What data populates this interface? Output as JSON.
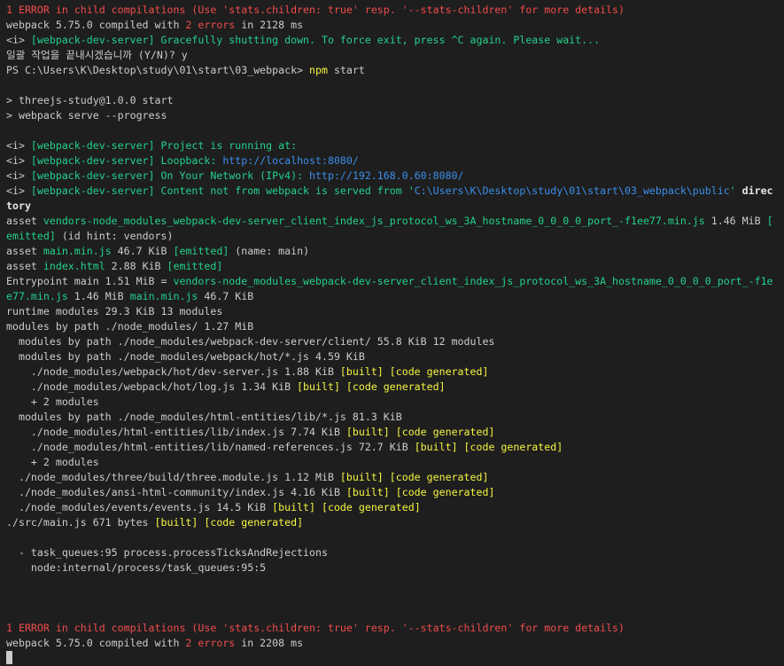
{
  "terminal": {
    "colors": {
      "background": "#1e1e1e",
      "text": "#cccccc",
      "error": "#f14c4c",
      "success": "#23d18b",
      "link": "#3b8eea",
      "highlight": "#f5f543"
    },
    "lines": [
      [
        [
          "1 ERROR in child compilations (Use 'stats.children: true' resp. '--stats-children' for more details)",
          "r"
        ]
      ],
      [
        [
          "webpack 5.75.0 compiled with ",
          ""
        ],
        [
          "2 errors",
          "r"
        ],
        [
          " in 2128 ms",
          ""
        ]
      ],
      [
        [
          "<i> ",
          ""
        ],
        [
          "[webpack-dev-server] Gracefully shutting down. To force exit, press ^C again. Please wait...",
          "g"
        ]
      ],
      [
        [
          "일괄 작업을 끝내시겠습니까 (Y/N)? y",
          ""
        ]
      ],
      [
        [
          "PS C:\\Users\\K\\Desktop\\study\\01\\start\\03_webpack> ",
          ""
        ],
        [
          "npm",
          "y"
        ],
        [
          " start",
          ""
        ]
      ],
      [],
      [
        [
          "> threejs-study@1.0.0 start",
          ""
        ]
      ],
      [
        [
          "> webpack serve --progress",
          ""
        ]
      ],
      [],
      [
        [
          "<i> ",
          ""
        ],
        [
          "[webpack-dev-server] Project is running at:",
          "g"
        ]
      ],
      [
        [
          "<i> ",
          ""
        ],
        [
          "[webpack-dev-server] Loopback: ",
          "g"
        ],
        [
          "http://localhost:8080/",
          "b"
        ]
      ],
      [
        [
          "<i> ",
          ""
        ],
        [
          "[webpack-dev-server] On Your Network (IPv4): ",
          "g"
        ],
        [
          "http://192.168.0.60:8080/",
          "b"
        ]
      ],
      [
        [
          "<i> ",
          ""
        ],
        [
          "[webpack-dev-server] Content not from webpack is served from '",
          "g"
        ],
        [
          "C:\\Users\\K\\Desktop\\study\\01\\start\\03_webpack\\public",
          "b"
        ],
        [
          "'",
          "g"
        ],
        [
          " direc",
          "w"
        ]
      ],
      [
        [
          "tory",
          "w"
        ]
      ],
      [
        [
          "asset ",
          ""
        ],
        [
          "vendors-node_modules_webpack-dev-server_client_index_js_protocol_ws_3A_hostname_0_0_0_0_port_-f1ee77.min.js",
          "g"
        ],
        [
          " 1.46 MiB ",
          ""
        ],
        [
          "[",
          "g"
        ]
      ],
      [
        [
          "emitted]",
          "g"
        ],
        [
          " (id hint: vendors)",
          ""
        ]
      ],
      [
        [
          "asset ",
          ""
        ],
        [
          "main.min.js",
          "g"
        ],
        [
          " 46.7 KiB ",
          ""
        ],
        [
          "[emitted]",
          "g"
        ],
        [
          " (name: main)",
          ""
        ]
      ],
      [
        [
          "asset ",
          ""
        ],
        [
          "index.html",
          "g"
        ],
        [
          " 2.88 KiB ",
          ""
        ],
        [
          "[emitted]",
          "g"
        ]
      ],
      [
        [
          "Entrypoint main 1.51 MiB = ",
          ""
        ],
        [
          "vendors-node_modules_webpack-dev-server_client_index_js_protocol_ws_3A_hostname_0_0_0_0_port_-f1e",
          "g"
        ]
      ],
      [
        [
          "e77.min.js",
          "g"
        ],
        [
          " 1.46 MiB ",
          ""
        ],
        [
          "main.min.js",
          "g"
        ],
        [
          " 46.7 KiB",
          ""
        ]
      ],
      [
        [
          "runtime modules 29.3 KiB 13 modules",
          ""
        ]
      ],
      [
        [
          "modules by path ./node_modules/ 1.27 MiB",
          ""
        ]
      ],
      [
        [
          "  modules by path ./node_modules/webpack-dev-server/client/ 55.8 KiB 12 modules",
          ""
        ]
      ],
      [
        [
          "  modules by path ./node_modules/webpack/hot/*.js 4.59 KiB",
          ""
        ]
      ],
      [
        [
          "    ./node_modules/webpack/hot/dev-server.js 1.88 KiB ",
          ""
        ],
        [
          "[built] [code generated]",
          "y"
        ]
      ],
      [
        [
          "    ./node_modules/webpack/hot/log.js 1.34 KiB ",
          ""
        ],
        [
          "[built] [code generated]",
          "y"
        ]
      ],
      [
        [
          "    + 2 modules",
          ""
        ]
      ],
      [
        [
          "  modules by path ./node_modules/html-entities/lib/*.js 81.3 KiB",
          ""
        ]
      ],
      [
        [
          "    ./node_modules/html-entities/lib/index.js 7.74 KiB ",
          ""
        ],
        [
          "[built] [code generated]",
          "y"
        ]
      ],
      [
        [
          "    ./node_modules/html-entities/lib/named-references.js 72.7 KiB ",
          ""
        ],
        [
          "[built] [code generated]",
          "y"
        ]
      ],
      [
        [
          "    + 2 modules",
          ""
        ]
      ],
      [
        [
          "  ./node_modules/three/build/three.module.js 1.12 MiB ",
          ""
        ],
        [
          "[built] [code generated]",
          "y"
        ]
      ],
      [
        [
          "  ./node_modules/ansi-html-community/index.js 4.16 KiB ",
          ""
        ],
        [
          "[built] [code generated]",
          "y"
        ]
      ],
      [
        [
          "  ./node_modules/events/events.js 14.5 KiB ",
          ""
        ],
        [
          "[built] [code generated]",
          "y"
        ]
      ],
      [
        [
          "./src/main.js 671 bytes ",
          ""
        ],
        [
          "[built] [code generated]",
          "y"
        ]
      ],
      [],
      [
        [
          "  - task_queues:95 process.processTicksAndRejections",
          ""
        ]
      ],
      [
        [
          "    node:internal/process/task_queues:95:5",
          ""
        ]
      ],
      [],
      [],
      [],
      [
        [
          "1 ERROR in child compilations (Use 'stats.children: true' resp. '--stats-children' for more details)",
          "r"
        ]
      ],
      [
        [
          "webpack 5.75.0 compiled with ",
          ""
        ],
        [
          "2 errors",
          "r"
        ],
        [
          " in 2208 ms",
          ""
        ]
      ]
    ]
  }
}
